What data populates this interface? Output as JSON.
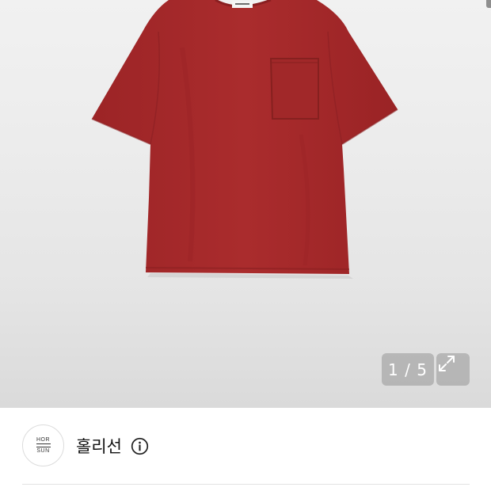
{
  "gallery": {
    "counter": "1 / 5",
    "expand_icon": "expand-arrows-icon",
    "product_color": "#a62a2c",
    "background_color": "#ececec"
  },
  "brand": {
    "logo_lines": [
      "HOR",
      "SUN"
    ],
    "name": "홀리선",
    "info_icon": "info-icon"
  }
}
